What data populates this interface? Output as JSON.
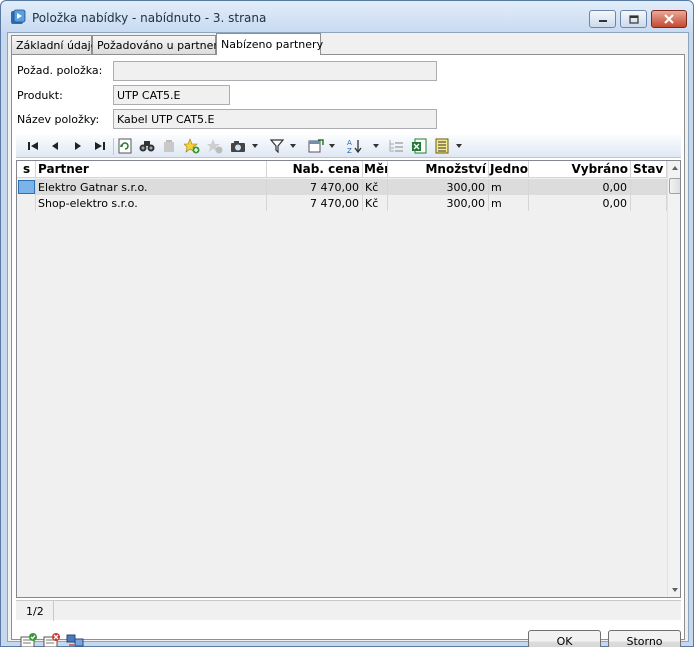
{
  "window": {
    "title": "Položka nabídky - nabídnuto - 3. strana"
  },
  "tabs": [
    {
      "label": "Základní údaje",
      "active": false
    },
    {
      "label": "Požadováno u partnerů",
      "active": false
    },
    {
      "label": "Nabízeno partnery",
      "active": true
    }
  ],
  "form": {
    "requested_item_label": "Požad. položka:",
    "requested_item_value": "",
    "product_label": "Produkt:",
    "product_value": "UTP CAT5.E",
    "item_name_label": "Název položky:",
    "item_name_value": "Kabel UTP CAT5.E"
  },
  "toolbar": {
    "icons": [
      "first-record-icon",
      "previous-record-icon",
      "next-record-icon",
      "last-record-icon",
      "refresh-icon",
      "find-icon",
      "delete-icon",
      "add-icon",
      "copy-icon",
      "camera-icon",
      "filter-icon",
      "columns-icon",
      "sort-icon",
      "tree-icon",
      "excel-export-icon",
      "report-icon"
    ]
  },
  "grid": {
    "columns": [
      "s",
      "Partner",
      "Nab. cena",
      "Měr",
      "Množství",
      "Jedno",
      "Vybráno",
      "Stav"
    ],
    "rows": [
      {
        "partner": "Elektro Gatnar s.r.o.",
        "price": "7 470,00",
        "currency": "Kč",
        "qty": "300,00",
        "unit": "m",
        "selected_qty": "0,00",
        "state": "",
        "selected": true
      },
      {
        "partner": "Shop-elektro s.r.o.",
        "price": "7 470,00",
        "currency": "Kč",
        "qty": "300,00",
        "unit": "m",
        "selected_qty": "0,00",
        "state": "",
        "selected": false
      }
    ]
  },
  "status": {
    "page_counter": "1/2"
  },
  "buttons": {
    "ok": "OK",
    "cancel": "Storno"
  },
  "colors": {
    "selection": "#7bb4ea",
    "window_frame": "#c6d8ee",
    "close_button": "#c24931"
  }
}
